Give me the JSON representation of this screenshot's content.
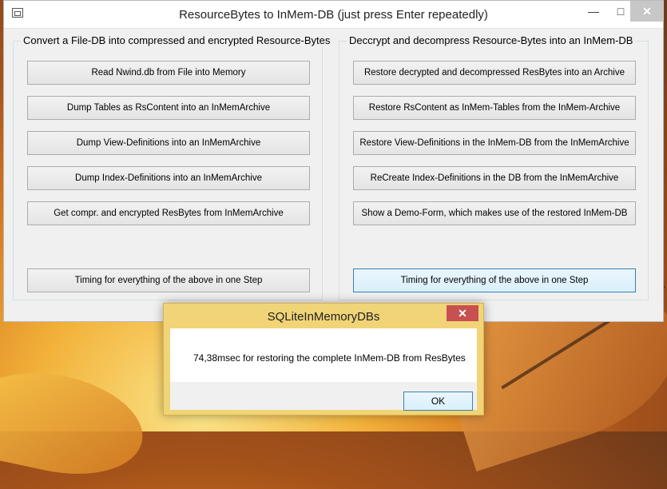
{
  "window": {
    "title": "ResourceBytes to InMem-DB (just press Enter repeatedly)",
    "minimize_glyph": "—",
    "maximize_glyph": "□",
    "close_glyph": "✕"
  },
  "left_group": {
    "label": "Convert a File-DB into compressed and encrypted Resource-Bytes",
    "buttons": [
      "Read Nwind.db from File into Memory",
      "Dump Tables as RsContent into an InMemArchive",
      "Dump View-Definitions into an InMemArchive",
      "Dump Index-Definitions into an InMemArchive",
      "Get compr. and encrypted ResBytes from InMemArchive"
    ],
    "timing_button": "Timing for everything of the above in one Step"
  },
  "right_group": {
    "label": "Deccrypt and decompress Resource-Bytes into an InMem-DB",
    "buttons": [
      "Restore decrypted and decompressed ResBytes into an Archive",
      "Restore RsContent as InMem-Tables from the InMem-Archive",
      "Restore View-Definitions in the InMem-DB from the InMemArchive",
      "ReCreate Index-Definitions in the DB from the InMemArchive",
      "Show a Demo-Form, which makes use of the restored InMem-DB"
    ],
    "timing_button": "Timing for everything of the above in one Step"
  },
  "dialog": {
    "title": "SQLiteInMemoryDBs",
    "close_glyph": "✕",
    "message": "74,38msec for restoring the complete InMem-DB from ResBytes",
    "ok_label": "OK"
  },
  "colors": {
    "dialog_frame": "#f0d477",
    "close_red": "#c75050",
    "focus_blue": "#3c7fb1"
  }
}
